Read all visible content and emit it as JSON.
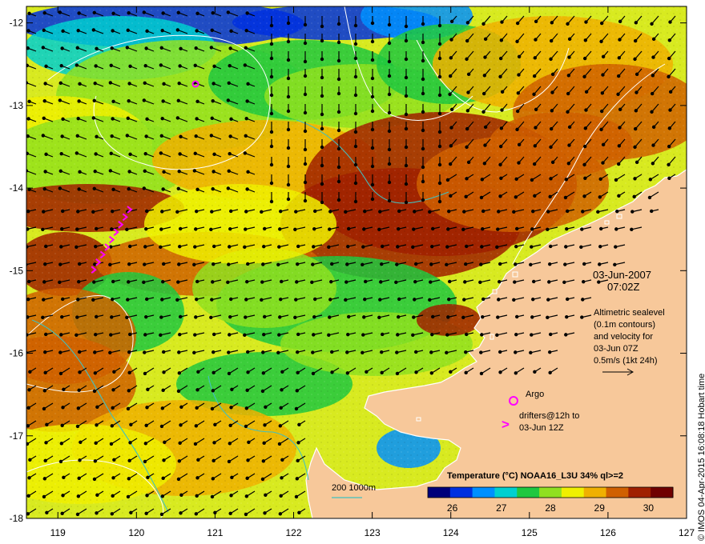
{
  "axes": {
    "lon_ticks": [
      "119",
      "120",
      "121",
      "122",
      "123",
      "124",
      "125",
      "126",
      "127"
    ],
    "lat_ticks": [
      "-12",
      "-13",
      "-14",
      "-15",
      "-16",
      "-17",
      "-18"
    ],
    "lon_range": [
      118.6,
      127.0
    ],
    "lat_range": [
      -11.8,
      -18.0
    ]
  },
  "annotations": {
    "date": "03-Jun-2007",
    "time": "07:02Z",
    "altimetry_lines": [
      "Altimetric sealevel",
      "(0.1m contours)",
      "and velocity for",
      "03-Jun 07Z",
      "0.5m/s (1kt 24h)"
    ],
    "argo_label": "Argo",
    "drifters_lines": [
      "drifters@12h to",
      "03-Jun 12Z"
    ],
    "drifter_symbol": ">",
    "bathymetry_label": "200  1000m"
  },
  "colorbar": {
    "title": "Temperature (°C) NOAA16_L3U 34% ql>=2",
    "ticks": [
      "26",
      "27",
      "28",
      "29",
      "30"
    ],
    "range": [
      25.5,
      30.5
    ],
    "colors": [
      "#00007a",
      "#0030e0",
      "#0090ff",
      "#00d0d0",
      "#20c840",
      "#90e020",
      "#f0f000",
      "#f0b000",
      "#d06000",
      "#a02000",
      "#700000"
    ]
  },
  "credit": "© IMOS 04-Apr-2015 16:08:18 Hobart time",
  "colors": {
    "land": "#f7c89a",
    "coast": "#ffffff",
    "bathy_line": "#40c0c0",
    "contour": "#ffffff",
    "argo": "#ff00ff",
    "drifter": "#ff00ff"
  }
}
